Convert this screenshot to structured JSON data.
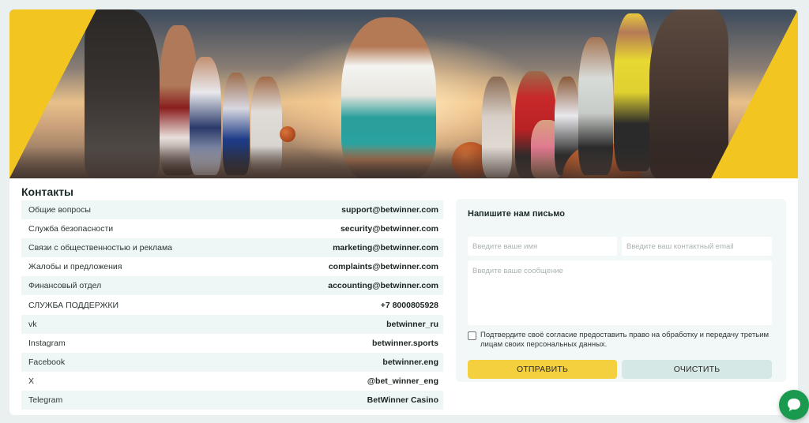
{
  "contacts": {
    "title": "Контакты",
    "rows": [
      {
        "label": "Общие вопросы",
        "value": "support@betwinner.com"
      },
      {
        "label": "Служба безопасности",
        "value": "security@betwinner.com"
      },
      {
        "label": "Связи с общественностью и реклама",
        "value": "marketing@betwinner.com"
      },
      {
        "label": "Жалобы и предложения",
        "value": "complaints@betwinner.com"
      },
      {
        "label": "Финансовый отдел",
        "value": "accounting@betwinner.com"
      },
      {
        "label": "СЛУЖБА ПОДДЕРЖКИ",
        "value": "+7 8000805928"
      },
      {
        "label": "vk",
        "value": "betwinner_ru"
      },
      {
        "label": "Instagram",
        "value": "betwinner.sports"
      },
      {
        "label": "Facebook",
        "value": "betwinner.eng"
      },
      {
        "label": "X",
        "value": "@bet_winner_eng"
      },
      {
        "label": "Telegram",
        "value": "BetWinner Casino"
      }
    ]
  },
  "form": {
    "title": "Напишите нам письмо",
    "name_placeholder": "Введите ваше имя",
    "email_placeholder": "Введите ваш контактный email",
    "message_placeholder": "Введите ваше сообщение",
    "consent_text": "Подтвердите своё согласие предоставить право на обработку и передачу третьим лицам своих персональных данных.",
    "consent_checked": false,
    "send_label": "ОТПРАВИТЬ",
    "clear_label": "ОЧИСТИТЬ"
  },
  "colors": {
    "accent_yellow": "#f4d03f",
    "clear_button": "#d6e8e5",
    "chat_green": "#1a9a4e"
  },
  "icons": {
    "chat": "chat-bubble-icon"
  }
}
